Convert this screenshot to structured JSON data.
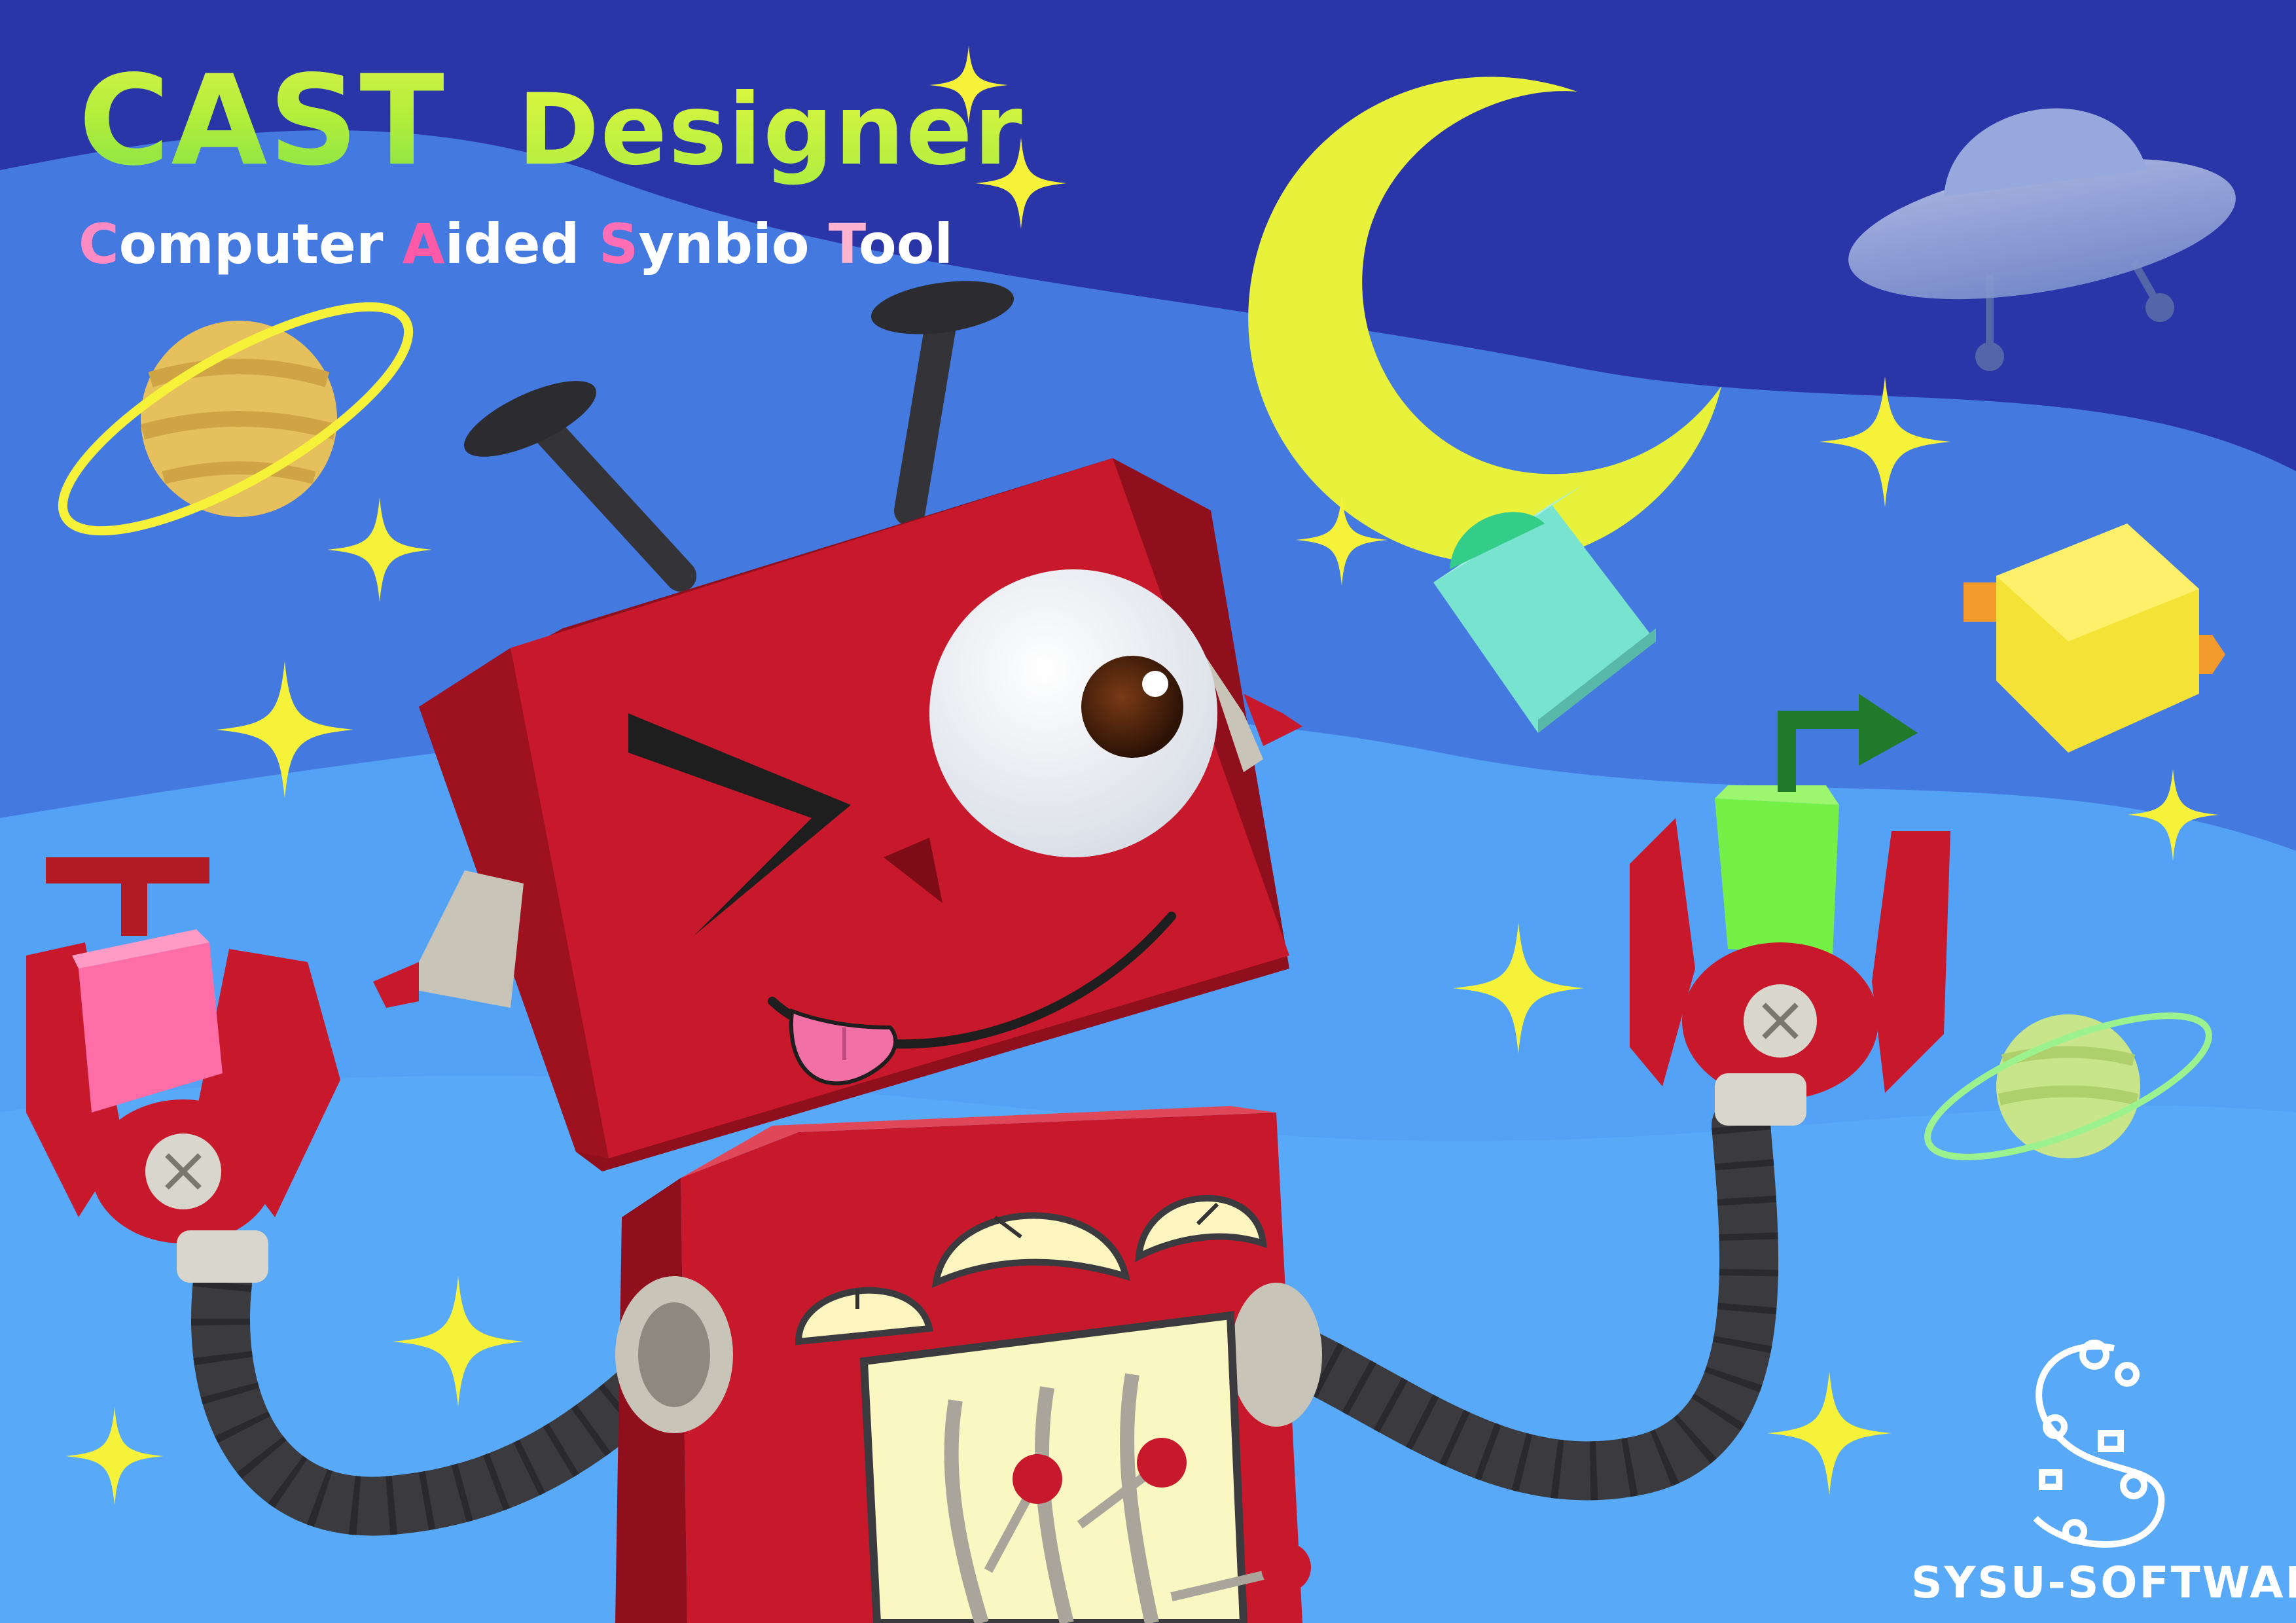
{
  "title": {
    "main": "CAST",
    "secondary": "Designer"
  },
  "subtitle": {
    "words": [
      {
        "initial": "C",
        "rest": "omputer"
      },
      {
        "initial": "A",
        "rest": "ided"
      },
      {
        "initial": "S",
        "rest": "ynbio"
      },
      {
        "initial": "T",
        "rest": "ool"
      }
    ]
  },
  "brand": {
    "name": "SYSU-SOFTWARE"
  },
  "colors": {
    "sky_top": "#2f3fb4",
    "sky_mid": "#4d7fe6",
    "sky_bottom": "#58a4f5",
    "robot_red": "#c8192c",
    "robot_dark": "#8f0f1c",
    "star_yellow": "#f6f23a",
    "moon": "#e8f23a",
    "hose": "#3b3b3f"
  },
  "icons": [
    "moon-icon",
    "star-icon",
    "planet-icon",
    "ufo-icon",
    "robot-illustration",
    "cube-icon",
    "arrow-icon",
    "sysu-logo-icon"
  ]
}
